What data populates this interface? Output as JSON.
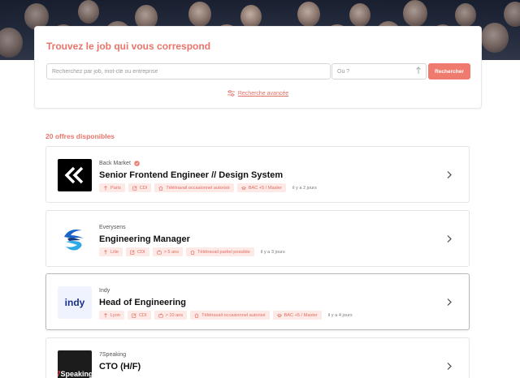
{
  "search": {
    "title": "Trouvez le job qui vous correspond",
    "query_placeholder": "Recherchez par job, mot-clé ou entreprise",
    "location_placeholder": "Où ?",
    "button_label": "Rechercher",
    "advanced_label": "Recherche avancée"
  },
  "results": {
    "count_label": "20 offres disponibles"
  },
  "colors": {
    "accent": "#ef7b6e",
    "tag_bg": "#fde9e6"
  },
  "jobs": [
    {
      "company": "Back Market",
      "verified": true,
      "title": "Senior Frontend Engineer // Design System",
      "logo_icon": "back-market-logo",
      "tags": [
        {
          "icon": "location-pin-icon",
          "label": "Paris"
        },
        {
          "icon": "contract-icon",
          "label": "CDI"
        },
        {
          "icon": "home-icon",
          "label": "Télétravail occasionnel autorisé"
        },
        {
          "icon": "graduation-cap-icon",
          "label": "BAC +5 / Master"
        }
      ],
      "posted": "il y a 2 jours"
    },
    {
      "company": "Everysens",
      "verified": false,
      "title": "Engineering Manager",
      "logo_icon": "everysens-logo",
      "tags": [
        {
          "icon": "location-pin-icon",
          "label": "Lille"
        },
        {
          "icon": "contract-icon",
          "label": "CDI"
        },
        {
          "icon": "briefcase-icon",
          "label": "> 5 ans"
        },
        {
          "icon": "home-icon",
          "label": "Télétravail partiel possible"
        }
      ],
      "posted": "il y a 3 jours"
    },
    {
      "company": "Indy",
      "verified": false,
      "title": "Head of Engineering",
      "logo_icon": "indy-logo",
      "logo_text": "indy",
      "tags": [
        {
          "icon": "location-pin-icon",
          "label": "Lyon"
        },
        {
          "icon": "contract-icon",
          "label": "CDI"
        },
        {
          "icon": "briefcase-icon",
          "label": "> 10 ans"
        },
        {
          "icon": "home-icon",
          "label": "Télétravail occasionnel autorisé"
        },
        {
          "icon": "graduation-cap-icon",
          "label": "BAC +5 / Master"
        }
      ],
      "posted": "il y a 4 jours"
    },
    {
      "company": "7Speaking",
      "verified": false,
      "title": "CTO (H/F)",
      "logo_icon": "7speaking-logo",
      "logo_text": "Speaking",
      "tags": [],
      "posted": ""
    }
  ]
}
